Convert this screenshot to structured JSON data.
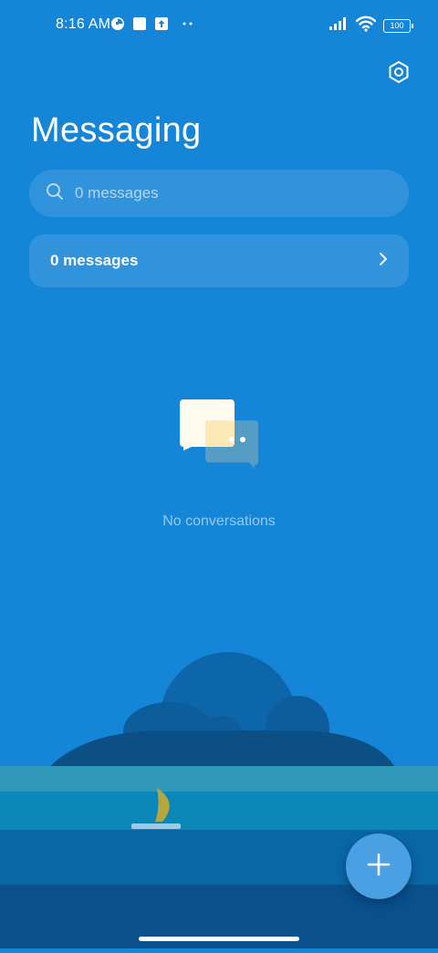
{
  "status_bar": {
    "time": "8:16 AM",
    "left_icons": [
      "data-saver-icon",
      "notification-square-icon",
      "upload-icon",
      "more-dots-icon"
    ],
    "right_icons": [
      "cellular-signal-icon",
      "wifi-icon",
      "battery-icon"
    ],
    "battery_level": "100"
  },
  "header": {
    "title": "Messaging",
    "settings_icon": "settings-hexagon-icon"
  },
  "search": {
    "placeholder": "0 messages",
    "value": "",
    "icon": "search-icon"
  },
  "messages_card": {
    "label": "0 messages",
    "icon": "chevron-right-icon"
  },
  "empty_state": {
    "icon": "chat-bubbles-icon",
    "label": "No conversations"
  },
  "fab": {
    "icon": "plus-icon"
  },
  "colors": {
    "background": "#1585d8",
    "fab": "#4aa0e3",
    "island_dark": "#0b4f85",
    "sea_light": "#2f97b8"
  }
}
